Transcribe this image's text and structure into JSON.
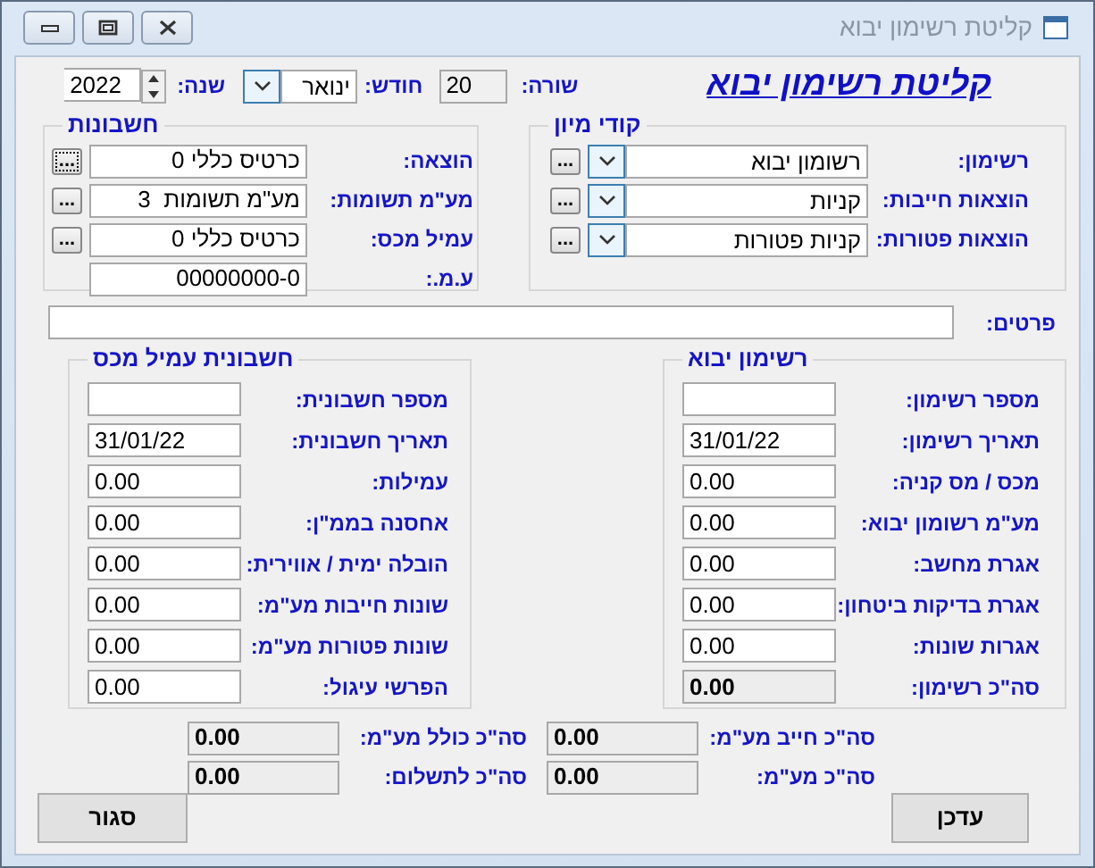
{
  "window": {
    "title": "קליטת רשימון יבוא"
  },
  "header": {
    "title": "קליטת רשימון יבוא",
    "row": {
      "label": "שורה:",
      "value": "20"
    },
    "month": {
      "label": "חודש:",
      "value": "ינואר"
    },
    "year": {
      "label": "שנה:",
      "value": "2022"
    }
  },
  "sort_codes": {
    "title": "קודי מיון",
    "rows": [
      {
        "label": "רשימון:",
        "value": "רשומון יבוא",
        "button": "..."
      },
      {
        "label": "הוצאות חייבות:",
        "value": "קניות",
        "button": "..."
      },
      {
        "label": "הוצאות פטורות:",
        "value": "קניות פטורות",
        "button": "..."
      }
    ]
  },
  "accounts": {
    "title": "חשבונות",
    "rows": [
      {
        "label": "הוצאה:",
        "value": "כרטיס כללי 0",
        "button": "...",
        "focused": true
      },
      {
        "label": "מע\"מ תשומות:",
        "value": "מע\"מ תשומות  3",
        "button": "...",
        "focused": false
      },
      {
        "label": "עמיל מכס:",
        "value": "כרטיס כללי 0",
        "button": "...",
        "focused": false
      },
      {
        "label": "ע.מ.:",
        "value": "00000000-0"
      }
    ]
  },
  "details": {
    "label": "פרטים:"
  },
  "import_entry": {
    "title": "רשימון יבוא",
    "fields": [
      {
        "label": "מספר רשימון:",
        "kind": "entry"
      },
      {
        "label": "תאריך רשימון:",
        "value": "31/01/22",
        "kind": "entry"
      },
      {
        "label": "מכס / מס קניה:",
        "value": "0.00",
        "kind": "entry"
      },
      {
        "label": "מע\"מ רשומון יבוא:",
        "value": "0.00",
        "kind": "entry"
      },
      {
        "label": "אגרת מחשב:",
        "value": "0.00",
        "kind": "entry"
      },
      {
        "label": "אגרת בדיקות ביטחון:",
        "value": "0.00",
        "kind": "entry"
      },
      {
        "label": "אגרות שונות:",
        "value": "0.00",
        "kind": "entry"
      },
      {
        "label": "סה\"כ רשימון:",
        "value": "0.00",
        "kind": "total"
      }
    ]
  },
  "invoice": {
    "title": "חשבונית עמיל מכס",
    "fields": [
      {
        "label": "מספר חשבונית:",
        "kind": "entry"
      },
      {
        "label": "תאריך חשבונית:",
        "value": "31/01/22",
        "kind": "entry"
      },
      {
        "label": "עמילות:",
        "value": "0.00",
        "kind": "entry"
      },
      {
        "label": "אחסנה בממ\"ן:",
        "value": "0.00",
        "kind": "entry"
      },
      {
        "label": "הובלה ימית / אווירית:",
        "value": "0.00",
        "kind": "entry"
      },
      {
        "label": "שונות חייבות מע\"מ:",
        "value": "0.00",
        "kind": "entry"
      },
      {
        "label": "שונות פטורות מע\"מ:",
        "value": "0.00",
        "kind": "entry"
      },
      {
        "label": "הפרשי עיגול:",
        "value": "0.00",
        "kind": "entry"
      }
    ]
  },
  "totals": [
    {
      "label": "סה\"כ חייב מע\"מ:",
      "value": "0.00"
    },
    {
      "label": "סה\"כ כולל מע\"מ:",
      "value": "0.00"
    },
    {
      "label": "סה\"כ מע\"מ:",
      "value": "0.00"
    },
    {
      "label": "סה\"כ לתשלום:",
      "value": "0.00"
    }
  ],
  "buttons": [
    {
      "label": "עדכן"
    },
    {
      "label": "סגור"
    }
  ]
}
